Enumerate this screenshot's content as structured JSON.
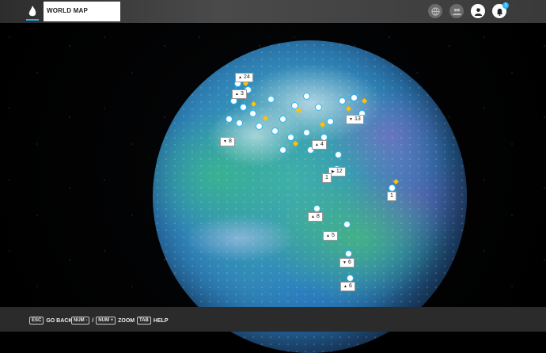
{
  "header": {
    "title": "WORLD MAP",
    "icons": [
      "globe-icon",
      "friends-icon",
      "profile-icon",
      "notification-icon"
    ],
    "notification_count": "1"
  },
  "map": {
    "clusters": [
      {
        "id": "c1",
        "label": "24"
      },
      {
        "id": "c2",
        "label": "3"
      },
      {
        "id": "c3",
        "label": "13"
      },
      {
        "id": "c4",
        "label": "8"
      },
      {
        "id": "c5",
        "label": "4"
      },
      {
        "id": "c6",
        "label": "12"
      },
      {
        "id": "c7",
        "label": "1"
      },
      {
        "id": "c8",
        "label": "1"
      },
      {
        "id": "c9",
        "label": "8"
      },
      {
        "id": "c10",
        "label": "5"
      },
      {
        "id": "c11",
        "label": "6"
      },
      {
        "id": "c12",
        "label": "6"
      }
    ],
    "accent_color": "#29b6f6",
    "pin_color": "#ffc107"
  },
  "footer": {
    "back_key": "ESC",
    "back_label": "GO BACK",
    "zoom_key_minus": "NUM -",
    "zoom_sep": "/",
    "zoom_key_plus": "NUM +",
    "zoom_label": "ZOOM",
    "help_key": "TAB",
    "help_label": "HELP"
  }
}
